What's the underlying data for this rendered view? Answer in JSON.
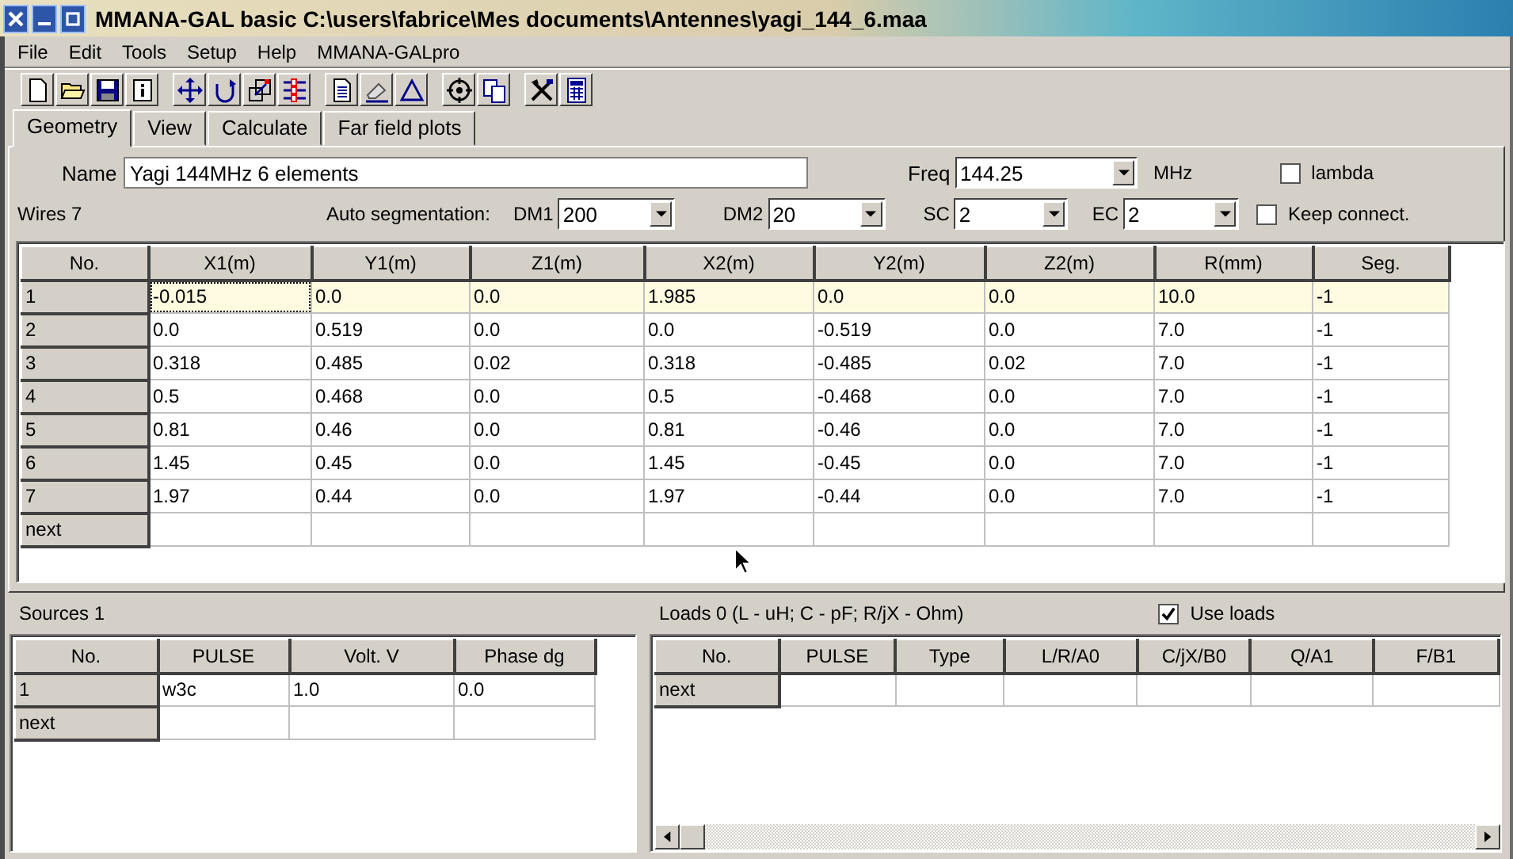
{
  "window": {
    "title": "MMANA-GAL basic C:\\users\\fabrice\\Mes documents\\Antennes\\yagi_144_6.maa"
  },
  "menu": [
    "File",
    "Edit",
    "Tools",
    "Setup",
    "Help",
    "MMANA-GALpro"
  ],
  "tabs": [
    {
      "label": "Geometry",
      "selected": true
    },
    {
      "label": "View",
      "selected": false
    },
    {
      "label": "Calculate",
      "selected": false
    },
    {
      "label": "Far field plots",
      "selected": false
    }
  ],
  "name": {
    "label": "Name",
    "value": "Yagi 144MHz 6 elements"
  },
  "freq": {
    "label": "Freq",
    "value": "144.25",
    "unit": "MHz"
  },
  "lambda": {
    "label": "lambda",
    "checked": false
  },
  "wires_label": "Wires 7",
  "auto_segmentation": {
    "label": "Auto segmentation:",
    "fields": [
      {
        "label": "DM1",
        "value": "200"
      },
      {
        "label": "DM2",
        "value": "20"
      },
      {
        "label": "SC",
        "value": "2"
      },
      {
        "label": "EC",
        "value": "2"
      }
    ]
  },
  "keep_connect": {
    "label": "Keep connect.",
    "checked": false
  },
  "wires_table": {
    "columns": [
      "No.",
      "X1(m)",
      "Y1(m)",
      "Z1(m)",
      "X2(m)",
      "Y2(m)",
      "Z2(m)",
      "R(mm)",
      "Seg."
    ],
    "rows": [
      {
        "selected": true,
        "cells": [
          "1",
          "-0.015",
          "0.0",
          "0.0",
          "1.985",
          "0.0",
          "0.0",
          "10.0",
          "-1"
        ]
      },
      {
        "selected": false,
        "cells": [
          "2",
          "0.0",
          "0.519",
          "0.0",
          "0.0",
          "-0.519",
          "0.0",
          "7.0",
          "-1"
        ]
      },
      {
        "selected": false,
        "cells": [
          "3",
          "0.318",
          "0.485",
          "0.02",
          "0.318",
          "-0.485",
          "0.02",
          "7.0",
          "-1"
        ]
      },
      {
        "selected": false,
        "cells": [
          "4",
          "0.5",
          "0.468",
          "0.0",
          "0.5",
          "-0.468",
          "0.0",
          "7.0",
          "-1"
        ]
      },
      {
        "selected": false,
        "cells": [
          "5",
          "0.81",
          "0.46",
          "0.0",
          "0.81",
          "-0.46",
          "0.0",
          "7.0",
          "-1"
        ]
      },
      {
        "selected": false,
        "cells": [
          "6",
          "1.45",
          "0.45",
          "0.0",
          "1.45",
          "-0.45",
          "0.0",
          "7.0",
          "-1"
        ]
      },
      {
        "selected": false,
        "cells": [
          "7",
          "1.97",
          "0.44",
          "0.0",
          "1.97",
          "-0.44",
          "0.0",
          "7.0",
          "-1"
        ]
      },
      {
        "selected": false,
        "cells": [
          "next"
        ]
      }
    ]
  },
  "sources": {
    "label": "Sources 1",
    "columns": [
      "No.",
      "PULSE",
      "Volt. V",
      "Phase dg"
    ],
    "rows": [
      {
        "cells": [
          "1",
          "w3c",
          "1.0",
          "0.0"
        ]
      },
      {
        "cells": [
          "next"
        ]
      }
    ]
  },
  "loads": {
    "label": "Loads 0 (L - uH; C - pF; R/jX - Ohm)",
    "use_loads": {
      "label": "Use loads",
      "checked": true
    },
    "columns": [
      "No.",
      "PULSE",
      "Type",
      "L/R/A0",
      "C/jX/B0",
      "Q/A1",
      "F/B1"
    ],
    "rows": [
      {
        "cells": [
          "next"
        ]
      }
    ]
  }
}
